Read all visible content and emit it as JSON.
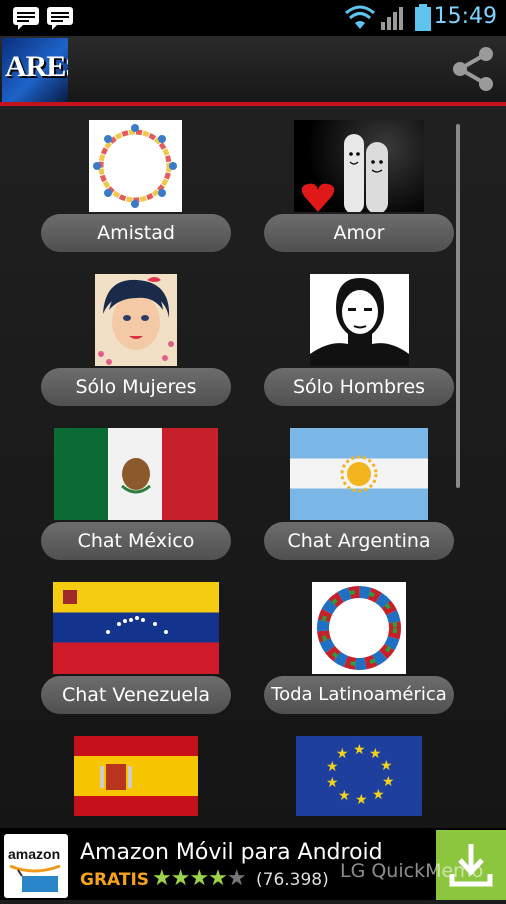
{
  "status_bar": {
    "time": "15:49"
  },
  "app_bar": {
    "logo_text": "ARES"
  },
  "tiles": [
    {
      "label": "Amistad"
    },
    {
      "label": "Amor"
    },
    {
      "label": "Sólo Mujeres"
    },
    {
      "label": "Sólo Hombres"
    },
    {
      "label": "Chat México"
    },
    {
      "label": "Chat Argentina"
    },
    {
      "label": "Chat Venezuela"
    },
    {
      "label": "Toda Latinoamérica"
    },
    {
      "label": ""
    },
    {
      "label": ""
    }
  ],
  "ad": {
    "logo_text": "amazon",
    "title": "Amazon Móvil para Android",
    "price": "GRATIS",
    "rating": 4,
    "rating_count": "(76.398)"
  },
  "watermark": "LG QuickMemo",
  "colors": {
    "accent_red": "#c3121c",
    "status_clock": "#7fd4ff",
    "ad_green": "#8cc63f",
    "price_orange": "#f7a21b"
  }
}
